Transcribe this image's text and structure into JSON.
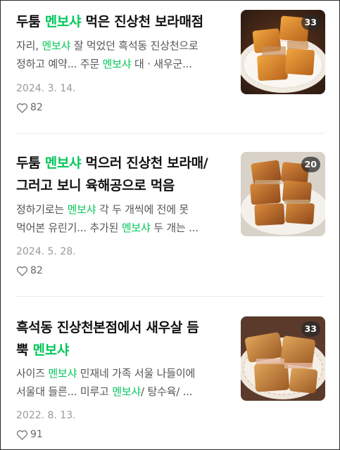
{
  "posts": [
    {
      "title": [
        {
          "t": "두툼 "
        },
        {
          "t": "멘보샤",
          "hl": true
        },
        {
          "t": " 먹은 진상천 보라매점"
        }
      ],
      "snippet": [
        {
          "t": "자리, "
        },
        {
          "t": "멘보샤",
          "hl": true
        },
        {
          "t": " 잘 먹었던 흑석동 진상천으로\n정하고 예약... 주문 "
        },
        {
          "t": "멘보샤",
          "hl": true
        },
        {
          "t": " 대 · 새우군..."
        }
      ],
      "date": "2024. 3. 14.",
      "likes": "82",
      "photo_count": "33",
      "thumbnail": "fried shrimp toast (menbosha) on white doily plate"
    },
    {
      "title": [
        {
          "t": "두툼 "
        },
        {
          "t": "멘보샤",
          "hl": true
        },
        {
          "t": " 먹으러 진상천 보라매/\n그러고 보니 육해공으로 먹음"
        }
      ],
      "snippet": [
        {
          "t": "정하기로는 "
        },
        {
          "t": "멘보샤",
          "hl": true
        },
        {
          "t": " 각 두 개씩에 전에 못\n먹어본 유린기... 추가된 "
        },
        {
          "t": "멘보샤",
          "hl": true
        },
        {
          "t": " 두 개는 ..."
        }
      ],
      "date": "2024. 5. 28.",
      "likes": "82",
      "photo_count": "20",
      "thumbnail": "stacked fried shrimp toast on white plate"
    },
    {
      "title": [
        {
          "t": "흑석동 진상천본점에서 새우살 듬\n뿍 "
        },
        {
          "t": "멘보샤",
          "hl": true
        }
      ],
      "snippet": [
        {
          "t": "사이즈 "
        },
        {
          "t": "멘보샤",
          "hl": true
        },
        {
          "t": " 민재네 가족 서울 나들이에\n서울대 들른... 미루고 "
        },
        {
          "t": "멘보샤",
          "hl": true
        },
        {
          "t": "/ 탕수육/ ..."
        }
      ],
      "date": "2022. 8. 13.",
      "likes": "91",
      "photo_count": "33",
      "thumbnail": "fried shrimp toast on plate close-up"
    }
  ],
  "colors": {
    "highlight": "#03c75a",
    "date": "#999999",
    "snippet": "#555555"
  },
  "icons": {
    "like": "heart-outline-icon"
  }
}
